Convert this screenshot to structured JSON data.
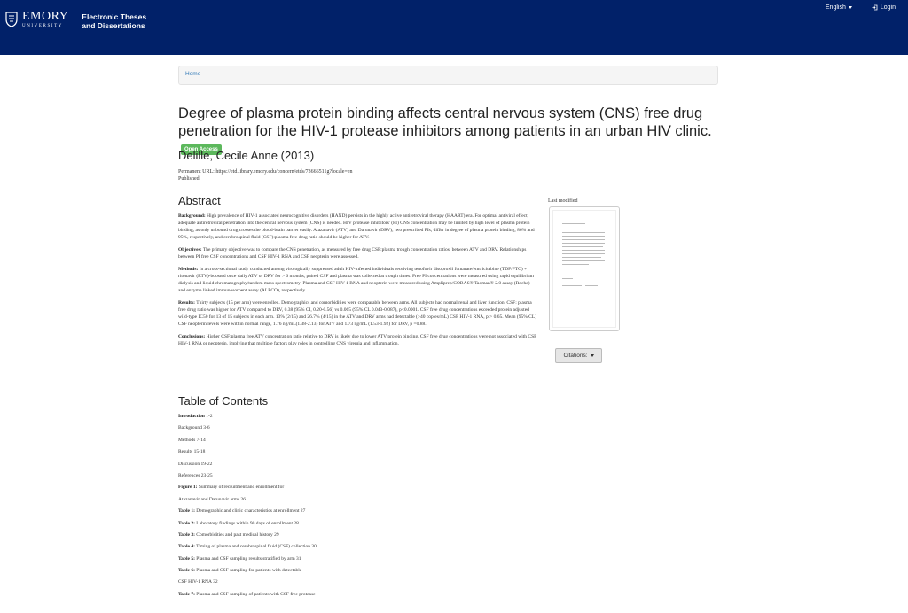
{
  "header": {
    "logo_main": "EMORY",
    "logo_sub": "UNIVERSITY",
    "site_title_line1": "Electronic Theses",
    "site_title_line2": "and Dissertations",
    "language": "English",
    "login": "Login",
    "brand_color": "#012169"
  },
  "breadcrumb": {
    "home": "Home"
  },
  "record": {
    "title": "Degree of plasma protein binding affects central nervous system (CNS) free drug penetration for the HIV-1 protease inhibitors among patients in an urban HIV clinic.",
    "badge": "Open Access",
    "author": "Delille, Cecile Anne (2013)",
    "permalink": "Permanent URL: https://etd.library.emory.edu/concern/etds/73666511g?locale=en",
    "status": "Published"
  },
  "abstract": {
    "heading": "Abstract",
    "paragraphs": [
      {
        "label": "Background:",
        "text": " High prevalence of HIV-1 associated neurocognitive disorders (HAND) persists in the highly active antiretroviral therapy (HAART) era. For optimal antiviral effect, adequate antiretroviral penetration into the central nervous system (CNS) is needed. HIV protease inhibitors' (PI) CNS concentration may be limited by high level of plasma protein binding, as only unbound drug crosses the blood-brain barrier easily. Atazanavir (ATV) and Darunavir (DRV), two prescribed PIs, differ in degree of plasma protein binding, 86% and 95%, respectively, and cerebrospinal fluid (CSF):plasma free drug ratio should be higher for ATV."
      },
      {
        "label": "Objectives:",
        "text": " The primary objective was to compare the CNS penetration, as measured by free drug CSF:plasma trough concentration ratios, between ATV and DRV. Relationships between PI free CSF concentrations and CSF HIV-1 RNA and CSF neopterin were assessed."
      },
      {
        "label": "Methods:",
        "text": " In a cross-sectional study conducted among virologically suppressed adult HIV-infected individuals receiving tenofovir disoproxil fumarate/emtricitabine (TDF/FTC) + ritonavir (RTV)-boosted once daily ATV or DRV for > 6 months, paired CSF and plasma was collected at trough times. Free PI concentrations were measured using rapid equilibrium dialysis and liquid chromatography/tandem mass spectrometry. Plasma and CSF HIV-1 RNA and neopterin were measured using Ampliprep/COBAS® Taqman® 2.0 assay (Roche) and enzyme linked immunosorbent assay (ALPCO), respectively."
      },
      {
        "label": "Results:",
        "text": " Thirty subjects (15 per arm) were enrolled. Demographics and comorbidities were comparable between arms. All subjects had normal renal and liver function. CSF: plasma free drug ratio was higher for ATV compared to DRV, 0.38 (95% CI, 0.20-0.56) vs 0.065 (95% CL 0.043-0.087), p<0.0001. CSF free drug concentrations exceeded protein adjusted wild-type IC50 for 13 of 15 subjects in each arm. 13% (2/15) and 26.7% (4/15) in the ATV and DRV arms had detectable (>40 copies/mL) CSF HIV-1 RNA, p > 0.65. Mean (95% CL) CSF neopterin levels were within normal range, 1.76 ng/mL(1.38-2.13) for ATV and 1.73 ng/mL (1.53-1.92) for DRV, p =0.88."
      },
      {
        "label": "Conclusions:",
        "text": " Higher CSF:plasma free ATV concentration ratio relative to DRV is likely due to lower ATV protein binding. CSF free drug concentrations were not associated with CSF HIV-1 RNA or neopterin, implying that multiple factors play roles in controlling CNS viremia and inflammation."
      }
    ]
  },
  "toc": {
    "heading": "Table of Contents",
    "items": [
      {
        "bold": "Introduction",
        "text": " 1-2"
      },
      {
        "bold": "",
        "text": "Background 3-6"
      },
      {
        "bold": "",
        "text": "Methods 7-14"
      },
      {
        "bold": "",
        "text": "Results 15-18"
      },
      {
        "bold": "",
        "text": "Discussion 19-22"
      },
      {
        "bold": "",
        "text": "References 23-25"
      },
      {
        "bold": "Figure 1:",
        "text": " Summary of recruitment and enrollment for"
      },
      {
        "bold": "",
        "text": "Atazanavir and Darunavir arms 26"
      },
      {
        "bold": "Table 1:",
        "text": " Demographic and clinic characteristics at enrollment 27"
      },
      {
        "bold": "Table 2:",
        "text": " Laboratory findings within 90 days of enrollment 28"
      },
      {
        "bold": "Table 3:",
        "text": " Comorbidities and past medical history 29"
      },
      {
        "bold": "Table 4:",
        "text": " Timing of plasma and cerebrospinal fluid (CSF) collection 30"
      },
      {
        "bold": "Table 5:",
        "text": " Plasma and CSF sampling results stratified by arm 31"
      },
      {
        "bold": "Table 6:",
        "text": " Plasma and CSF sampling for patients with detectable"
      },
      {
        "bold": "",
        "text": "CSF HIV-1 RNA 32"
      },
      {
        "bold": "Table 7:",
        "text": " Plasma and CSF sampling of patients with CSF free protease"
      }
    ]
  },
  "sidebar": {
    "thumb_label": "Last modified",
    "citations": "Citations:"
  }
}
